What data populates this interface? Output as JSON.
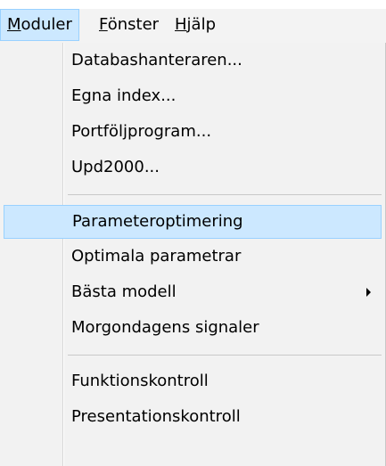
{
  "menubar": {
    "items": [
      {
        "label": "Moduler",
        "active": true
      },
      {
        "label": "Fönster",
        "active": false
      },
      {
        "label": "Hjälp",
        "active": false
      }
    ]
  },
  "dropdown": {
    "items": [
      {
        "label": "Databashanteraren..."
      },
      {
        "label": "Egna index..."
      },
      {
        "label": "Portföljprogram..."
      },
      {
        "label": "Upd2000..."
      },
      {
        "label": "Parameteroptimering",
        "highlighted": true
      },
      {
        "label": "Optimala parametrar"
      },
      {
        "label": "Bästa modell",
        "submenu": true
      },
      {
        "label": "Morgondagens signaler"
      },
      {
        "label": "Funktionskontroll"
      },
      {
        "label": "Presentationskontroll"
      }
    ]
  },
  "colors": {
    "highlight": "#cce8ff",
    "highlight_border": "#99d1ff",
    "menu_background": "#f2f2f2"
  }
}
